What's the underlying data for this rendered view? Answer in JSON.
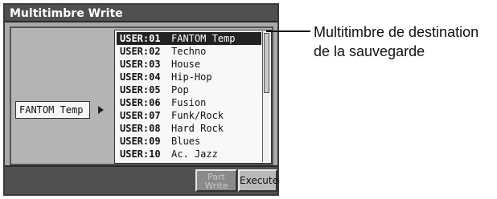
{
  "dialog": {
    "title": "Multitimbre Write",
    "source_name": "FANTOM Temp",
    "list": [
      {
        "num": "USER:01",
        "name": "FANTOM Temp"
      },
      {
        "num": "USER:02",
        "name": "Techno"
      },
      {
        "num": "USER:03",
        "name": "House"
      },
      {
        "num": "USER:04",
        "name": "Hip-Hop"
      },
      {
        "num": "USER:05",
        "name": "Pop"
      },
      {
        "num": "USER:06",
        "name": "Fusion"
      },
      {
        "num": "USER:07",
        "name": "Funk/Rock"
      },
      {
        "num": "USER:08",
        "name": "Hard Rock"
      },
      {
        "num": "USER:09",
        "name": "Blues"
      },
      {
        "num": "USER:10",
        "name": "Ac. Jazz"
      }
    ],
    "selected_index": 0,
    "buttons": {
      "part_write_line1": "Part",
      "part_write_line2": "Write",
      "execute": "Execute"
    }
  },
  "annotation": {
    "line1": "Multitimbre de destination",
    "line2": "de la sauvegarde"
  }
}
